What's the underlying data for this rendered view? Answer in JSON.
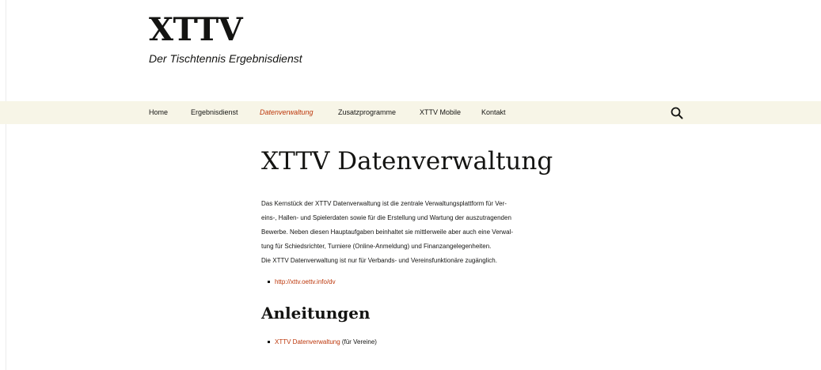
{
  "site": {
    "title": "XTTV",
    "description": "Der Tischtennis Ergebnisdienst"
  },
  "nav": {
    "items": [
      {
        "label": "Home"
      },
      {
        "label": "Ergebnisdienst"
      },
      {
        "label": "Datenverwaltung",
        "active": true
      },
      {
        "label": "Zusatzprogramme"
      },
      {
        "label": "XTTV Mobile"
      },
      {
        "label": "Kontakt"
      }
    ],
    "search_icon": "search-icon"
  },
  "content": {
    "title": "XTTV Datenverwaltung",
    "paragraph_lines": [
      "Das Kernstück der XTTV Datenverwaltung ist die zentrale Verwaltungsplattform für Ver-",
      "eins-, Hallen- und Spielerdaten sowie für die Erstellung und Wartung der auszutragenden",
      "Bewerbe. Neben diesen Hauptaufgaben beinhaltet sie mittlerweile aber auch eine Verwal-",
      "tung für Schiedsrichter, Turniere (Online-Anmeldung) und Finanzangelegenheiten.",
      "Die XTTV Datenverwaltung ist nur für Verbands- und Vereinsfunktionäre zugänglich."
    ],
    "link1": "http://xttv.oettv.info/dv",
    "subheading": "Anleitungen",
    "guide_link": "XTTV Datenverwaltung",
    "guide_suffix": " (für Vereine)"
  },
  "colors": {
    "accent": "#bc360a",
    "navbar_bg": "#f7f5e7",
    "text": "#141412"
  }
}
